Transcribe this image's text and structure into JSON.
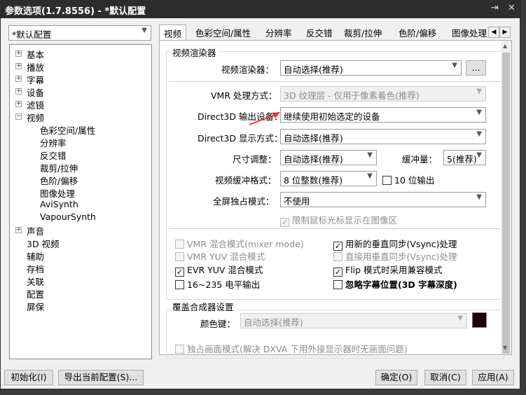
{
  "window": {
    "title": "参数选项(1.7.8556) - *默认配置",
    "pin": "⇥",
    "close": "✕"
  },
  "profile": {
    "value": "*默认配置"
  },
  "tree": {
    "items": [
      {
        "label": "基本",
        "exp": "+"
      },
      {
        "label": "播放",
        "exp": "+"
      },
      {
        "label": "字幕",
        "exp": "+"
      },
      {
        "label": "设备",
        "exp": "+"
      },
      {
        "label": "滤镜",
        "exp": "+"
      },
      {
        "label": "视频",
        "exp": "−"
      },
      {
        "label": "色彩空间/属性"
      },
      {
        "label": "分辨率"
      },
      {
        "label": "反交错"
      },
      {
        "label": "裁剪/拉伸"
      },
      {
        "label": "色阶/偏移"
      },
      {
        "label": "图像处理"
      },
      {
        "label": "AviSynth"
      },
      {
        "label": "VapourSynth"
      },
      {
        "label": "声音",
        "exp": "+"
      },
      {
        "label": "3D 视频"
      },
      {
        "label": "辅助"
      },
      {
        "label": "存档"
      },
      {
        "label": "关联"
      },
      {
        "label": "配置"
      },
      {
        "label": "屏保"
      }
    ]
  },
  "tabs": [
    "视频",
    "色彩空间/属性",
    "分辨率",
    "反交错",
    "裁剪/拉伸",
    "色阶/偏移",
    "图像处理"
  ],
  "renderer": {
    "group": "视频渲染器",
    "renderer_label": "视频渲染器：",
    "renderer_value": "自动选择(推荐)",
    "more": "...",
    "vmr_mode_label": "VMR 处理方式：",
    "vmr_mode_value": "3D 纹理层 - 仅用于像素着色(推荐)",
    "d3d_device_label": "Direct3D 输出设备：",
    "d3d_device_value": "继续使用初始选定的设备",
    "d3d_display_label": "Direct3D 显示方式：",
    "d3d_display_value": "自动选择(推荐)",
    "resize_label": "尺寸调整：",
    "resize_value": "自动选择(推荐)",
    "buffer_label": "缓冲量：",
    "buffer_value": "5(推荐)",
    "surface_label": "视频缓冲格式：",
    "surface_value": "8 位整数(推荐)",
    "output10_label": "10 位输出",
    "fullscreen_label": "全屏独占模式：",
    "fullscreen_value": "不使用",
    "limit_cursor": "限制鼠标光标显示在图像区",
    "vmr_mixer": "VMR 混合模式(mixer mode)",
    "vmr_yuv": "VMR YUV 混合模式",
    "evr_yuv": "EVR YUV 混合模式",
    "levels": "16~235 电平输出",
    "vsync_new": "用新的垂直同步(Vsync)处理",
    "vsync_direct": "直接用垂直同步(Vsync)处理",
    "flip": "Flip 模式时采用兼容模式",
    "ignore_sub": "忽略字幕位置(3D 字幕深度)"
  },
  "overlay": {
    "group": "覆盖合成器设置",
    "color_key_label": "颜色键：",
    "color_key_value": "自动选择(推荐)",
    "swatch_color": "#1a0008",
    "exclusive": "独占画面模式(解决 DXVA 下用外接显示器时无画面问题)"
  },
  "footer": {
    "init": "初始化(I)",
    "export": "导出当前配置(S)...",
    "ok": "确定(O)",
    "cancel": "取消(C)",
    "apply": "应用(A)"
  },
  "check": "✓",
  "annotation_color": "#e53935"
}
